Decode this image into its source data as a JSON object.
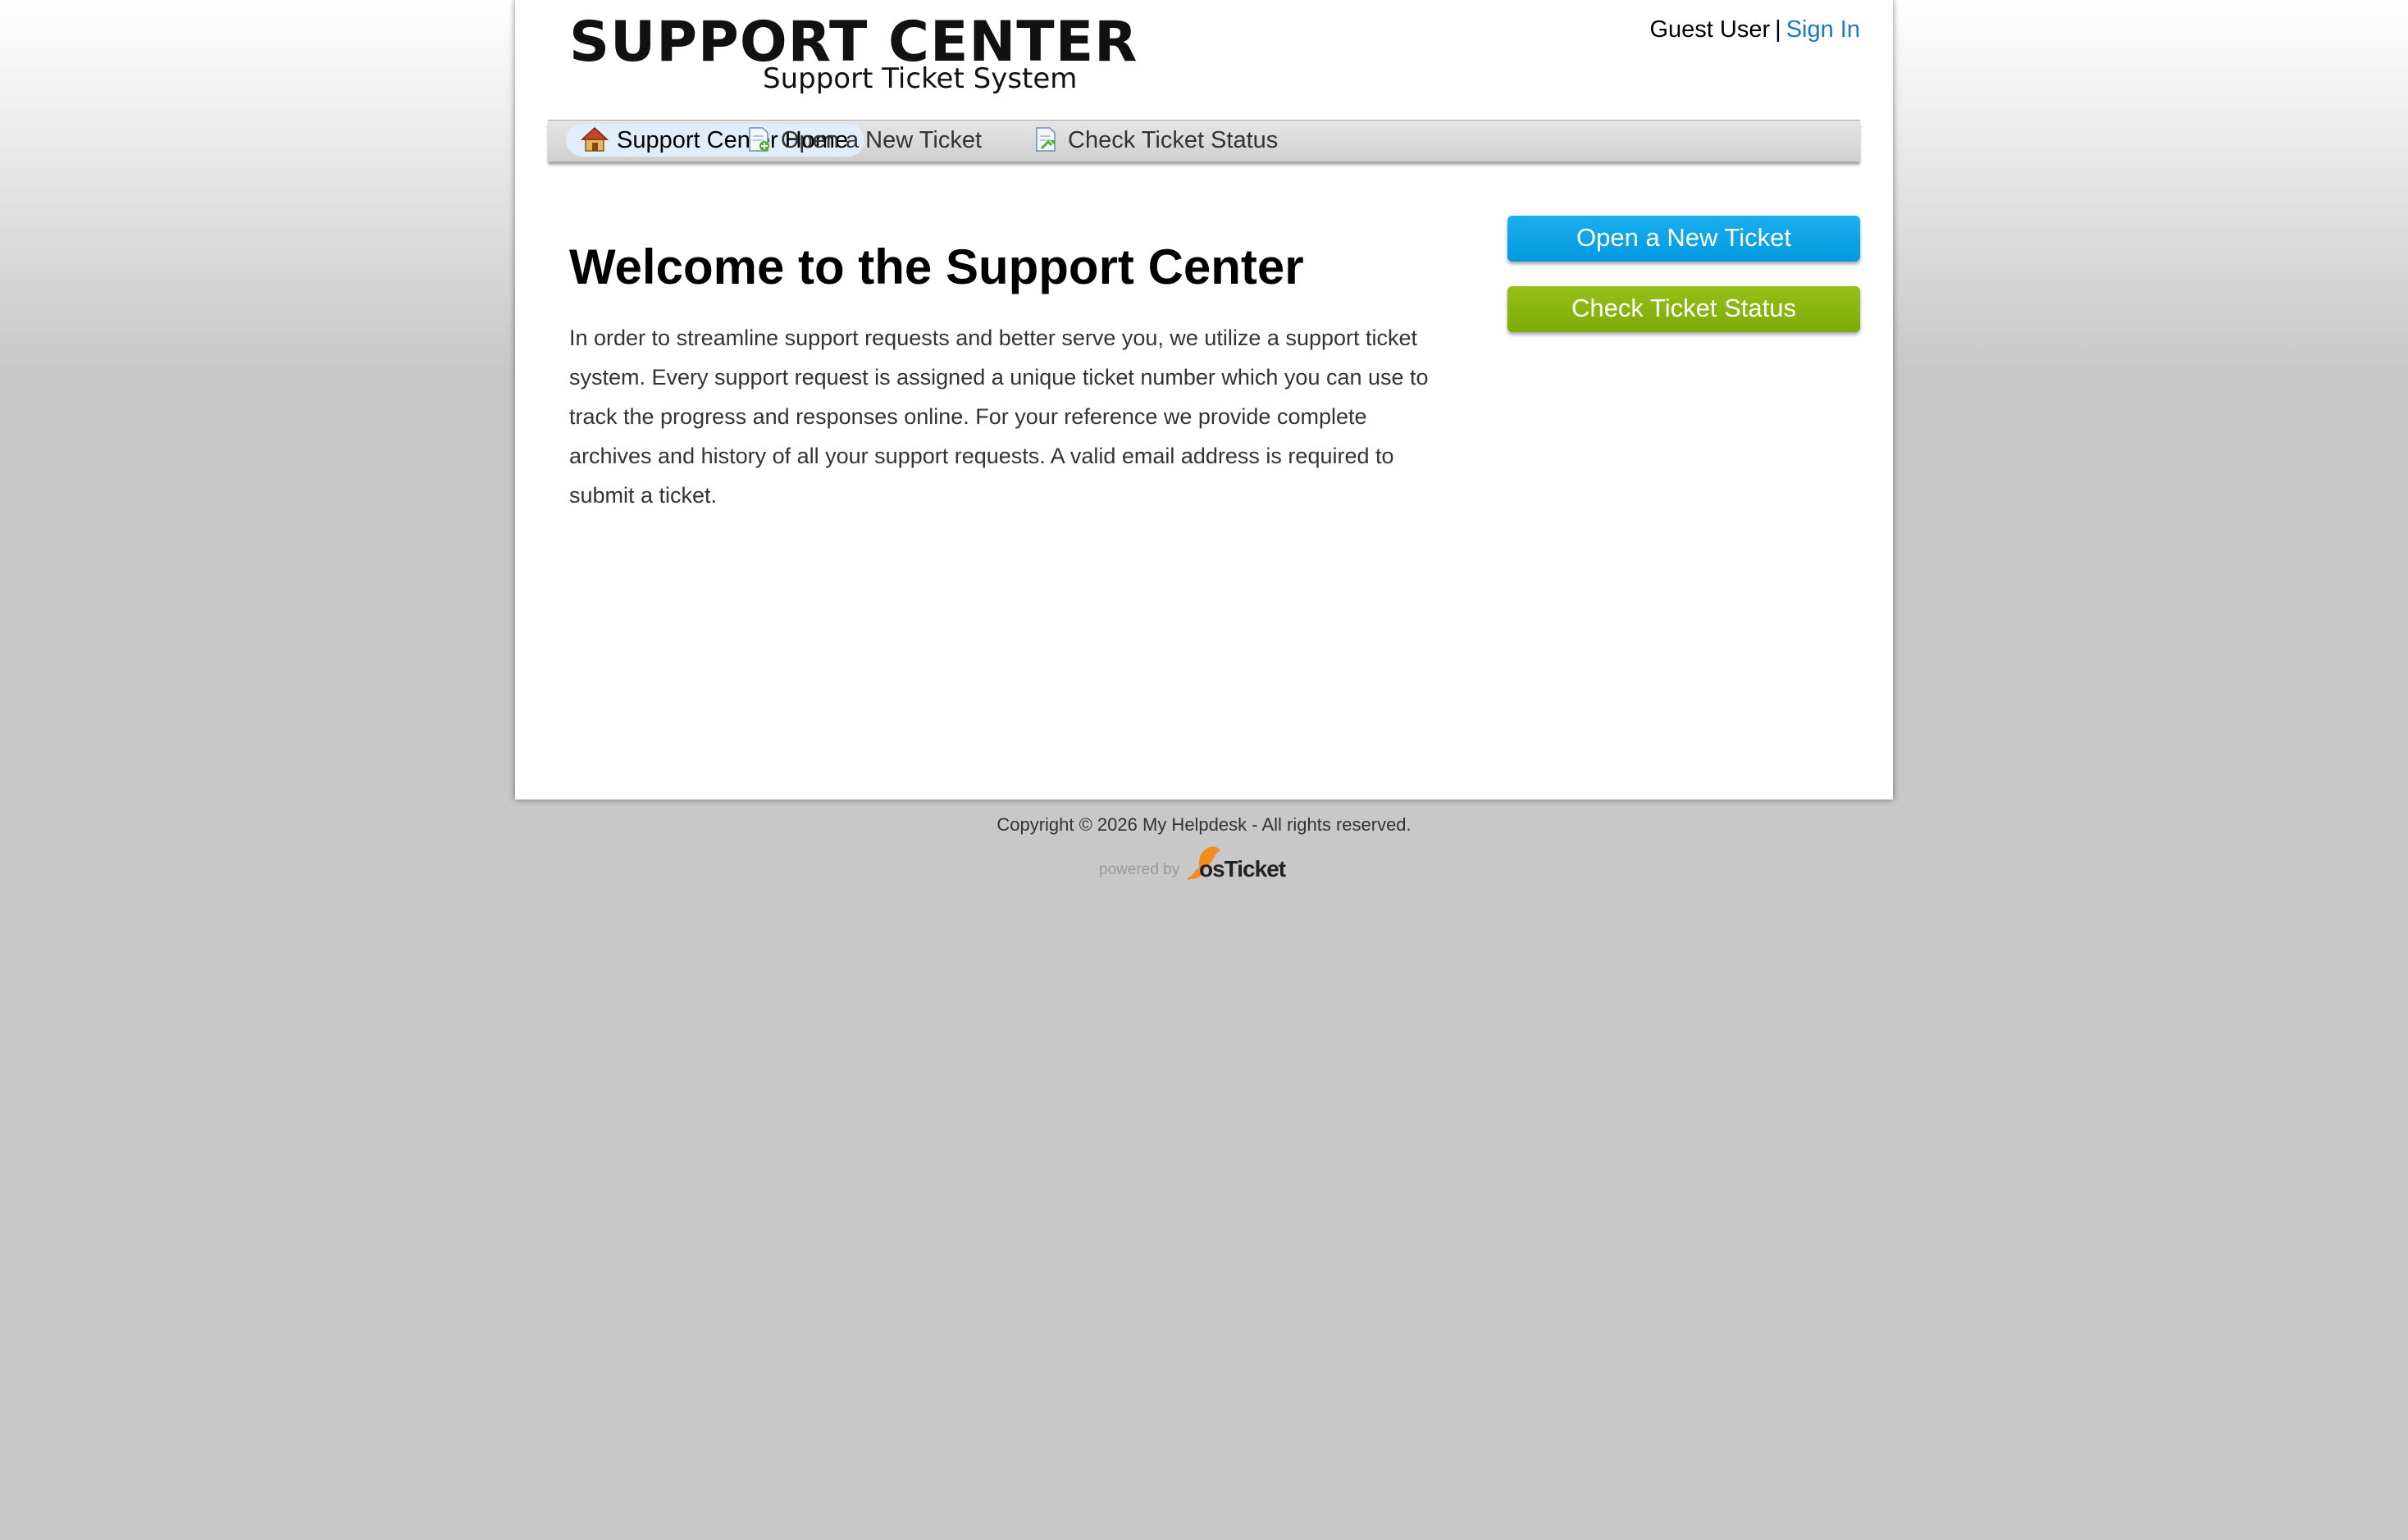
{
  "header": {
    "logo_title": "SUPPORT CENTER",
    "logo_subtitle": "Support Ticket System",
    "user_label": "Guest User",
    "separator": "|",
    "sign_in": "Sign In"
  },
  "nav": {
    "items": [
      {
        "label": "Support Center Home",
        "icon": "home-icon",
        "active": true
      },
      {
        "label": "Open a New Ticket",
        "icon": "new-ticket-icon",
        "active": false
      },
      {
        "label": "Check Ticket Status",
        "icon": "ticket-status-icon",
        "active": false
      }
    ]
  },
  "main": {
    "title": "Welcome to the Support Center",
    "body": "In order to streamline support requests and better serve you, we utilize a support ticket system. Every support request is assigned a unique ticket number which you can use to track the progress and responses online. For your reference we provide complete archives and history of all your support requests. A valid email address is required to submit a ticket."
  },
  "sidebar": {
    "open_ticket": "Open a New Ticket",
    "check_status": "Check Ticket Status"
  },
  "footer": {
    "copyright": "Copyright © 2026 My Helpdesk - All rights reserved.",
    "powered_by": "powered by",
    "brand": "osTicket"
  },
  "colors": {
    "link": "#1a78c8",
    "btn_blue": "#0a9fe3",
    "btn_green": "#86b40f",
    "nav_active": "#dfeefa"
  }
}
